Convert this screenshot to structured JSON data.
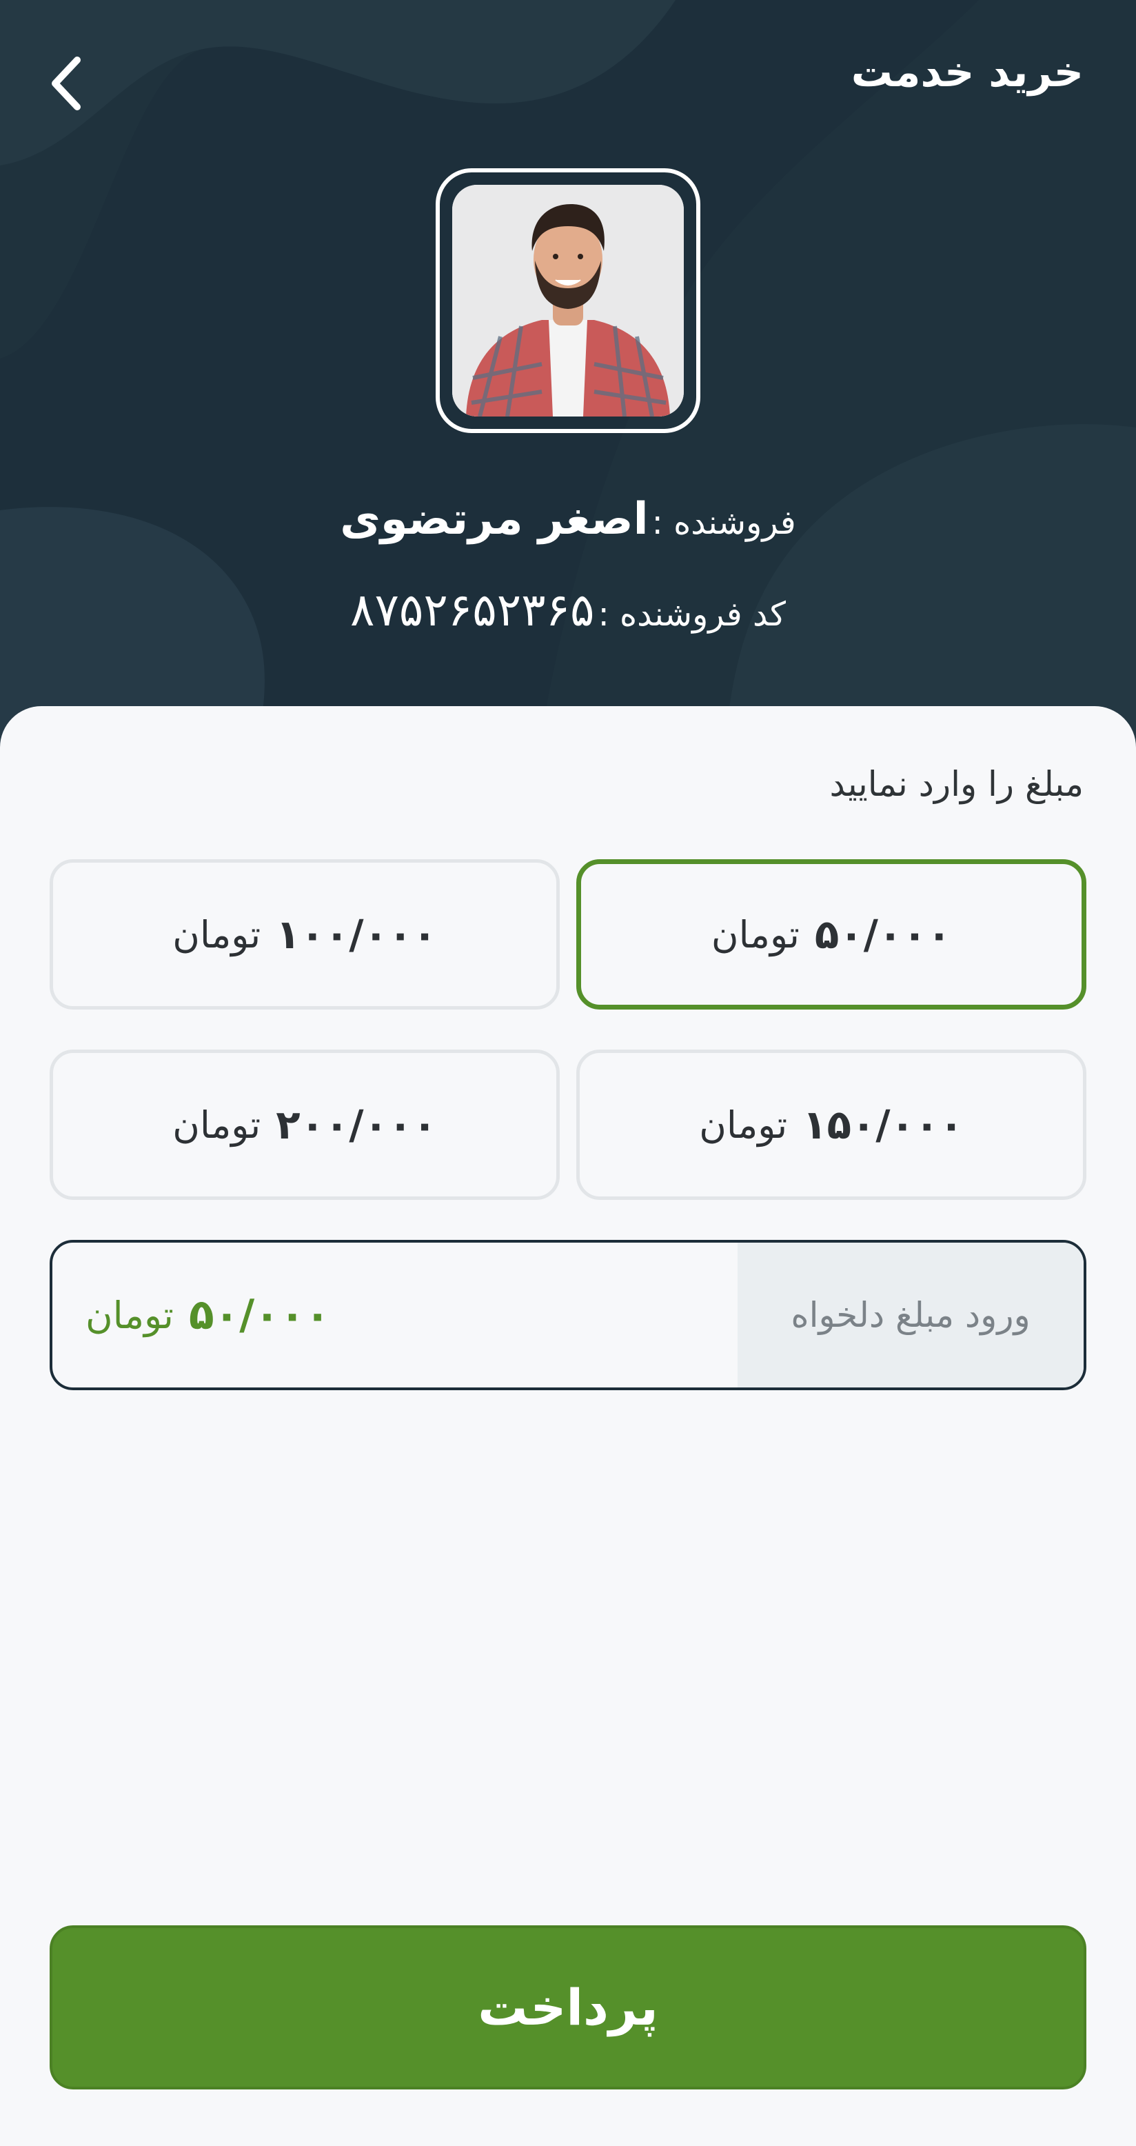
{
  "header": {
    "title": "خرید خدمت",
    "back_icon": "chevron-left-icon"
  },
  "seller": {
    "name_label": "فروشنده :",
    "name": "اصغر مرتضوی",
    "code_label": "کد فروشنده :",
    "code": "۸۷۵۲۶۵۲۳۶۵"
  },
  "amount_section": {
    "prompt": "مبلغ را وارد نمایید",
    "currency": "تومان",
    "options": [
      {
        "value": "۵۰/۰۰۰",
        "currency": "تومان",
        "selected": true
      },
      {
        "value": "۱۰۰/۰۰۰",
        "currency": "تومان",
        "selected": false
      },
      {
        "value": "۱۵۰/۰۰۰",
        "currency": "تومان",
        "selected": false
      },
      {
        "value": "۲۰۰/۰۰۰",
        "currency": "تومان",
        "selected": false
      }
    ]
  },
  "custom_amount": {
    "label": "ورود مبلغ دلخواه",
    "value": "۵۰/۰۰۰",
    "currency": "تومان"
  },
  "pay_button": {
    "label": "پرداخت"
  },
  "colors": {
    "header_bg": "#1d2f3b",
    "accent_green": "#55902a",
    "page_bg": "#f7f8fa"
  }
}
